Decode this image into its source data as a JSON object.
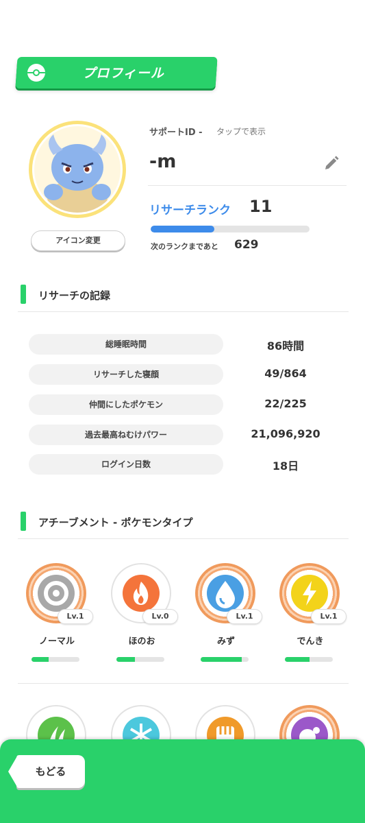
{
  "header": {
    "title": "プロフィール"
  },
  "profile": {
    "support_id_label": "サポートID -",
    "support_id_hint": "タップで表示",
    "username": "-m",
    "icon_change_label": "アイコン変更",
    "rank_label": "リサーチランク",
    "rank_value": "11",
    "rank_progress": 0.4,
    "next_rank_label": "次のランクまであと",
    "next_rank_value": "629"
  },
  "records": {
    "title": "リサーチの記録",
    "rows": [
      {
        "label": "総睡眠時間",
        "value": "86時間"
      },
      {
        "label": "リサーチした寝顔",
        "value": "49/864"
      },
      {
        "label": "仲間にしたポケモン",
        "value": "22/225"
      },
      {
        "label": "過去最高ねむけパワー",
        "value": "21,096,920"
      },
      {
        "label": "ログイン日数",
        "value": "18日"
      }
    ]
  },
  "achievements": {
    "title": "アチーブメント - ポケモンタイプ",
    "badges": [
      {
        "name": "ノーマル",
        "level": "Lv.1",
        "icon": "normal-type-icon",
        "color": "#a8a8a8",
        "progress": 0.35,
        "ring": "orange"
      },
      {
        "name": "ほのお",
        "level": "Lv.0",
        "icon": "fire-type-icon",
        "color": "#f4743b",
        "progress": 0.38,
        "ring": "gray"
      },
      {
        "name": "みず",
        "level": "Lv.1",
        "icon": "water-type-icon",
        "color": "#4a9fe3",
        "progress": 0.85,
        "ring": "orange"
      },
      {
        "name": "でんき",
        "level": "Lv.1",
        "icon": "electric-type-icon",
        "color": "#f3d31a",
        "progress": 0.52,
        "ring": "orange"
      }
    ],
    "badges_row2": [
      {
        "icon": "grass-type-icon",
        "color": "#5cc14a",
        "ring": "gray"
      },
      {
        "icon": "ice-type-icon",
        "color": "#4cc8dd",
        "ring": "gray"
      },
      {
        "icon": "fighting-type-icon",
        "color": "#f09a2a",
        "ring": "gray"
      },
      {
        "icon": "poison-type-icon",
        "color": "#9b58c9",
        "ring": "orange"
      }
    ]
  },
  "footer": {
    "back_label": "もどる"
  },
  "colors": {
    "accent": "#29d16a",
    "rank_blue": "#3d8bea"
  }
}
